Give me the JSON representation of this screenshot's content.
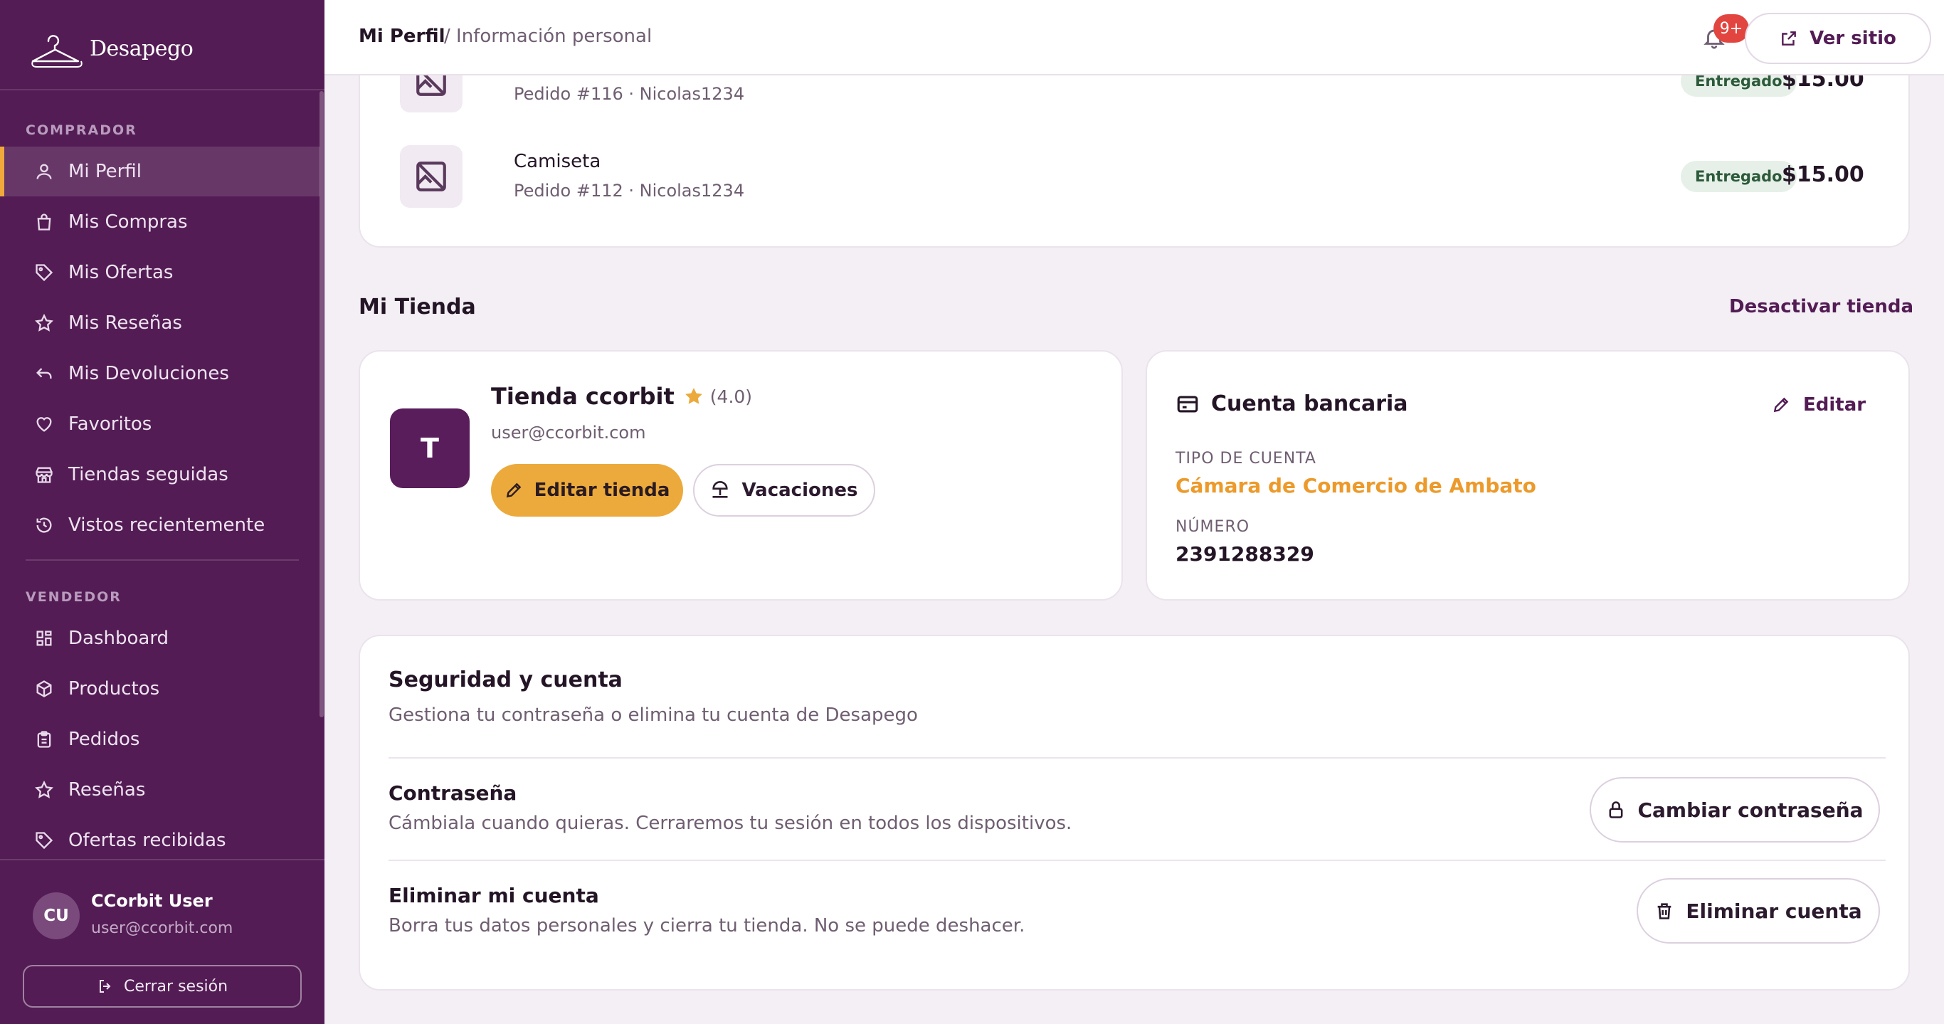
{
  "brand": {
    "name": "Desapego"
  },
  "sidebar": {
    "buyer_label": "COMPRADOR",
    "buyer_items": [
      {
        "label": "Mi Perfil",
        "icon": "user-icon",
        "active": true
      },
      {
        "label": "Mis Compras",
        "icon": "bag-icon"
      },
      {
        "label": "Mis Ofertas",
        "icon": "tag-icon"
      },
      {
        "label": "Mis Reseñas",
        "icon": "star-icon"
      },
      {
        "label": "Mis Devoluciones",
        "icon": "return-icon"
      },
      {
        "label": "Favoritos",
        "icon": "heart-icon"
      },
      {
        "label": "Tiendas seguidas",
        "icon": "store-icon"
      },
      {
        "label": "Vistos recientemente",
        "icon": "history-icon"
      }
    ],
    "seller_label": "VENDEDOR",
    "seller_items": [
      {
        "label": "Dashboard",
        "icon": "dashboard-icon"
      },
      {
        "label": "Productos",
        "icon": "box-icon"
      },
      {
        "label": "Pedidos",
        "icon": "clipboard-icon"
      },
      {
        "label": "Reseñas",
        "icon": "star-icon"
      },
      {
        "label": "Ofertas recibidas",
        "icon": "tag-icon"
      }
    ],
    "user": {
      "initials": "CU",
      "name": "CCorbit User",
      "email": "user@ccorbit.com"
    },
    "logout_label": "Cerrar sesión"
  },
  "topbar": {
    "crumb_current": "Mi Perfil",
    "crumb_sub": "/ Información personal",
    "notifications_badge": "9+",
    "view_site_label": "Ver sitio"
  },
  "orders": [
    {
      "name": "",
      "meta": "Pedido #116 · Nicolas1234",
      "status": "Entregado",
      "price": "$15.00"
    },
    {
      "name": "Camiseta",
      "meta": "Pedido #112 · Nicolas1234",
      "status": "Entregado",
      "price": "$15.00"
    }
  ],
  "store_section": {
    "title": "Mi Tienda",
    "deactivate_label": "Desactivar tienda",
    "store": {
      "initial": "T",
      "name": "Tienda ccorbit",
      "rating": "(4.0)",
      "email": "user@ccorbit.com",
      "edit_label": "Editar tienda",
      "vacation_label": "Vacaciones"
    },
    "bank": {
      "title": "Cuenta bancaria",
      "edit_label": "Editar",
      "type_label": "TIPO DE CUENTA",
      "type_value": "Cámara de Comercio de Ambato",
      "number_label": "NÚMERO",
      "number_value": "2391288329"
    }
  },
  "security": {
    "title": "Seguridad y cuenta",
    "subtitle": "Gestiona tu contraseña o elimina tu cuenta de Desapego",
    "password_title": "Contraseña",
    "password_sub": "Cámbiala cuando quieras. Cerraremos tu sesión en todos los dispositivos.",
    "password_button": "Cambiar contraseña",
    "delete_title": "Eliminar mi cuenta",
    "delete_sub": "Borra tus datos personales y cierra tu tienda. No se puede deshacer.",
    "delete_button": "Eliminar cuenta"
  },
  "colors": {
    "sidebar": "#531c54",
    "accent": "#ebaa3b",
    "accent_text": "#ec9a2b",
    "badge": "#e2453f"
  }
}
